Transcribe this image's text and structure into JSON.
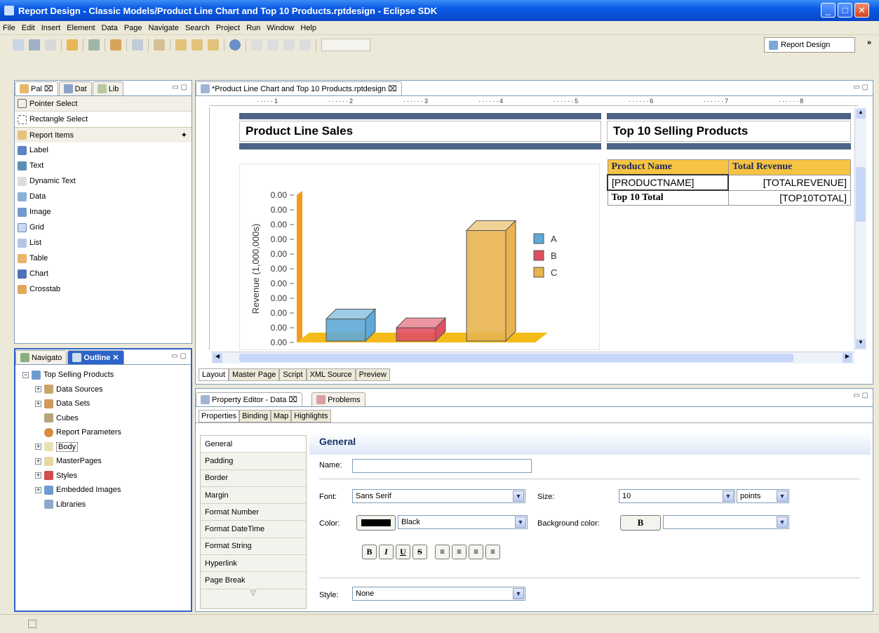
{
  "window": {
    "title": "Report Design - Classic Models/Product Line Chart and Top 10 Products.rptdesign - Eclipse SDK"
  },
  "menu": [
    "File",
    "Edit",
    "Insert",
    "Element",
    "Data",
    "Page",
    "Navigate",
    "Search",
    "Project",
    "Run",
    "Window",
    "Help"
  ],
  "toolbar": {
    "perspective": "Report Design",
    "overflow": "»"
  },
  "palette": {
    "tabs": [
      "Pal",
      "Dat",
      "Lib"
    ],
    "tools": [
      "Pointer Select",
      "Rectangle Select"
    ],
    "section": "Report Items",
    "items": [
      "Label",
      "Text",
      "Dynamic Text",
      "Data",
      "Image",
      "Grid",
      "List",
      "Table",
      "Chart",
      "Crosstab"
    ]
  },
  "outline": {
    "tabs": [
      "Navigato",
      "Outline"
    ],
    "root": "Top Selling Products",
    "items": [
      "Data Sources",
      "Data Sets",
      "Cubes",
      "Report Parameters",
      "Body",
      "MasterPages",
      "Styles",
      "Embedded Images",
      "Libraries"
    ]
  },
  "editor": {
    "tab": "*Product Line Chart and Top 10 Products.rptdesign",
    "ruler": [
      "1",
      "2",
      "3",
      "4",
      "5",
      "6",
      "7",
      "8"
    ],
    "left_title": "Product Line Sales",
    "right_title": "Top 10 Selling Products",
    "bottom_tabs": [
      "Layout",
      "Master Page",
      "Script",
      "XML Source",
      "Preview"
    ]
  },
  "top_table": {
    "headers": [
      "Product Name",
      "Total Revenue"
    ],
    "row": [
      "[PRODUCTNAME]",
      "[TOTALREVENUE]"
    ],
    "footer": [
      "Top 10 Total",
      "[TOP10TOTAL]"
    ]
  },
  "chart_data": {
    "type": "bar",
    "ylabel": "Revenue (1,000,000s)",
    "yticks": [
      "0.00",
      "0.00",
      "0.00",
      "0.00",
      "0.00",
      "0.00",
      "0.00",
      "0.00",
      "0.00",
      "0.00",
      "0.00"
    ],
    "series": [
      {
        "name": "A",
        "value": 0.15,
        "color": "#5ea9d6"
      },
      {
        "name": "B",
        "value": 0.09,
        "color": "#e05063"
      },
      {
        "name": "C",
        "value": 0.75,
        "color": "#e8b450"
      }
    ],
    "legend_position": "right"
  },
  "property_editor": {
    "tab": "Property Editor - Data",
    "problems_tab": "Problems",
    "subtabs": [
      "Properties",
      "Binding",
      "Map",
      "Highlights"
    ],
    "categories": [
      "General",
      "Padding",
      "Border",
      "Margin",
      "Format Number",
      "Format DateTime",
      "Format String",
      "Hyperlink",
      "Page Break"
    ],
    "section_title": "General",
    "name_label": "Name:",
    "name_value": "",
    "font_label": "Font:",
    "font_value": "Sans Serif",
    "size_label": "Size:",
    "size_value": "10",
    "size_unit": "points",
    "color_label": "Color:",
    "color_value": "Black",
    "bg_label": "Background color:",
    "bg_button": "B",
    "bg_value": "",
    "format_buttons": [
      "B",
      "I",
      "U",
      "S"
    ],
    "style_label": "Style:",
    "style_value": "None"
  }
}
